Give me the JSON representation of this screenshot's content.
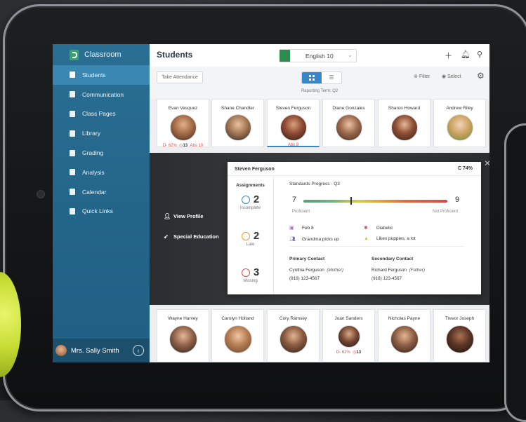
{
  "app": {
    "name": "Classroom"
  },
  "sidebar": {
    "items": [
      {
        "label": "Students",
        "active": true
      },
      {
        "label": "Communication"
      },
      {
        "label": "Class Pages"
      },
      {
        "label": "Library"
      },
      {
        "label": "Grading"
      },
      {
        "label": "Analysis"
      },
      {
        "label": "Calendar"
      },
      {
        "label": "Quick Links"
      }
    ],
    "user": "Mrs. Sally Smith",
    "collapse_glyph": "‹"
  },
  "header": {
    "title": "Students",
    "class_select": "English 10",
    "icons": [
      "plus-icon",
      "bell-icon",
      "search-icon"
    ]
  },
  "toolbar": {
    "take_attendance": "Take Attendance",
    "filter": "Filter",
    "select": "Select",
    "reporting_term": "Reporting Term: Q2"
  },
  "students_top": [
    {
      "name": "Evan Vasquez",
      "grade": "D- 62%",
      "missing": "13",
      "abs": "Abs 10"
    },
    {
      "name": "Shane Chandler"
    },
    {
      "name": "Steven Ferguson",
      "abs": "Abs 8"
    },
    {
      "name": "Diane Gonzales"
    },
    {
      "name": "Sharon Howard"
    },
    {
      "name": "Andrew Riley"
    }
  ],
  "detail": {
    "links": [
      "View Profile",
      "Special Education"
    ],
    "student_name": "Steven Ferguson",
    "grade": "C  74%",
    "assignments_header": "Assignments",
    "assignments": [
      {
        "count": "2",
        "label": "Incomplete",
        "color": "#3a86c8"
      },
      {
        "count": "2",
        "label": "Late",
        "color": "#e59c3c"
      },
      {
        "count": "3",
        "label": "Missing",
        "color": "#d94a4a"
      }
    ],
    "standards_header": "Standards Progress - Q3",
    "standards_min": "7",
    "standards_max": "9",
    "proficient": "Proficient",
    "not_proficient": "Not Proficient",
    "notes": [
      {
        "icon": "cake-icon",
        "text": "Feb 8"
      },
      {
        "icon": "medical-icon",
        "text": "Diabetic"
      },
      {
        "icon": "people-icon",
        "text": "Grandma picks up"
      },
      {
        "icon": "warning-icon",
        "text": "Likes puppies, a lot"
      }
    ],
    "primary_contact": {
      "header": "Primary Contact",
      "name": "Cynthia Ferguson",
      "relation": "(Mother)",
      "phone": "(916) 123-4567"
    },
    "secondary_contact": {
      "header": "Secondary Contact",
      "name": "Richard Ferguson",
      "relation": "(Father)",
      "phone": "(916) 123-4567"
    }
  },
  "students_bottom": [
    {
      "name": "Wayne Harvey"
    },
    {
      "name": "Carolyn Holland"
    },
    {
      "name": "Cory Ramsey"
    },
    {
      "name": "Joan Sanders",
      "grade": "D- 62%",
      "missing": "13"
    },
    {
      "name": "Nicholas Payne"
    },
    {
      "name": "Trevor Joseph"
    }
  ]
}
